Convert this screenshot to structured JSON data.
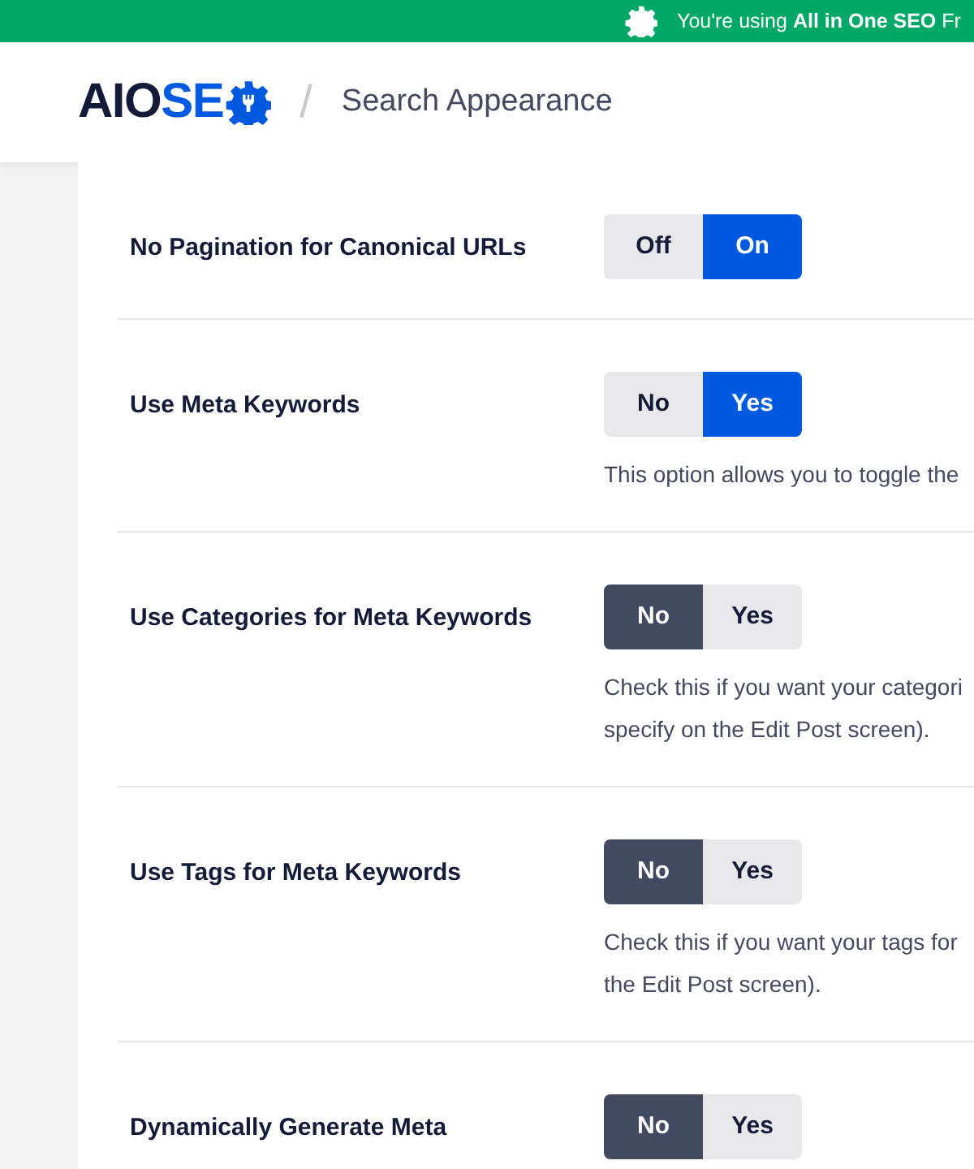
{
  "banner": {
    "text": "You're using **All in One SEO** Fr"
  },
  "header": {
    "logo_dark": "AIO",
    "logo_blue": "SE",
    "separator": "/",
    "title": "Search Appearance"
  },
  "settings": [
    {
      "label": "No Pagination for Canonical URLs",
      "options": [
        {
          "label": "Off",
          "selected": false
        },
        {
          "label": "On",
          "selected": true
        }
      ]
    },
    {
      "label": "Use Meta Keywords",
      "options": [
        {
          "label": "No",
          "selected": false
        },
        {
          "label": "Yes",
          "selected": true
        }
      ],
      "description": [
        "This option allows you to toggle the"
      ]
    },
    {
      "label": "Use Categories for Meta Keywords",
      "options": [
        {
          "label": "No",
          "selected": true
        },
        {
          "label": "Yes",
          "selected": false
        }
      ],
      "description": [
        "Check this if you want your categori",
        "specify on the Edit Post screen)."
      ]
    },
    {
      "label": "Use Tags for Meta Keywords",
      "options": [
        {
          "label": "No",
          "selected": true
        },
        {
          "label": "Yes",
          "selected": false
        }
      ],
      "description": [
        "Check this if you want your tags for",
        "the Edit Post screen)."
      ]
    },
    {
      "label": "Dynamically Generate Meta",
      "options": [
        {
          "label": "No",
          "selected": true
        },
        {
          "label": "Yes",
          "selected": false
        }
      ]
    }
  ]
}
